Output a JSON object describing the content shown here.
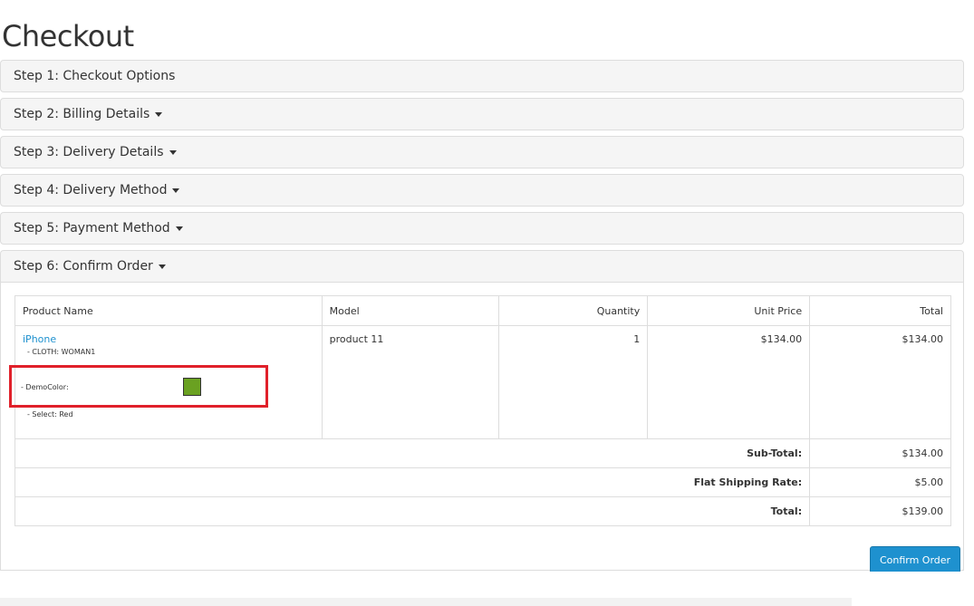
{
  "page": {
    "title": "Checkout"
  },
  "steps": [
    {
      "label": "Step 1: Checkout Options",
      "caret": false
    },
    {
      "label": "Step 2: Billing Details",
      "caret": true
    },
    {
      "label": "Step 3: Delivery Details",
      "caret": true
    },
    {
      "label": "Step 4: Delivery Method",
      "caret": true
    },
    {
      "label": "Step 5: Payment Method",
      "caret": true
    },
    {
      "label": "Step 6: Confirm Order",
      "caret": true
    }
  ],
  "order": {
    "headers": [
      "Product Name",
      "Model",
      "Quantity",
      "Unit Price",
      "Total"
    ],
    "product": {
      "name": "iPhone",
      "option_cloth": "- CLOTH: WOMAN1",
      "option_democolor": "- DemoColor:",
      "option_democolor_swatch": "#6aa121",
      "option_select": "- Select: Red",
      "model": "product 11",
      "quantity": "1",
      "unit_price": "$134.00",
      "total": "$134.00"
    },
    "totals": [
      {
        "label": "Sub-Total:",
        "value": "$134.00"
      },
      {
        "label": "Flat Shipping Rate:",
        "value": "$5.00"
      },
      {
        "label": "Total:",
        "value": "$139.00"
      }
    ]
  },
  "actions": {
    "confirm_label": "Confirm Order"
  },
  "colors": {
    "accent": "#1e91cf",
    "highlight": "#e0202a",
    "panel_bg": "#f5f5f5"
  }
}
